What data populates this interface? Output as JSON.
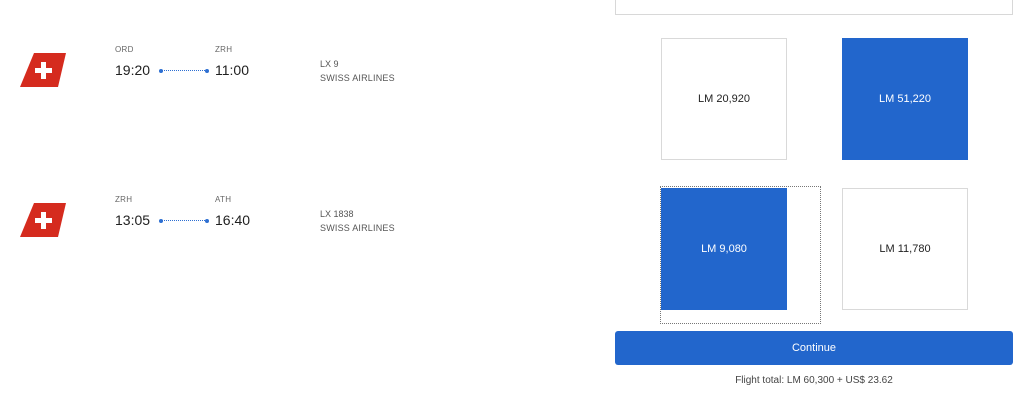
{
  "flights": [
    {
      "origin": "ORD",
      "destination": "ZRH",
      "departure_time": "19:20",
      "arrival_time": "11:00",
      "flight_number": "LX 9",
      "airline": "SWISS AIRLINES",
      "logo_icon": "swiss-tail-logo-icon"
    },
    {
      "origin": "ZRH",
      "destination": "ATH",
      "departure_time": "13:05",
      "arrival_time": "16:40",
      "flight_number": "LX 1838",
      "airline": "SWISS AIRLINES",
      "logo_icon": "swiss-tail-logo-icon"
    }
  ],
  "fares": [
    [
      {
        "price": "LM 20,920",
        "selected": false
      },
      {
        "price": "LM 51,220",
        "selected": true
      }
    ],
    [
      {
        "price": "LM 9,080",
        "selected": true
      },
      {
        "price": "LM 11,780",
        "selected": false
      }
    ]
  ],
  "continue_label": "Continue",
  "flight_total": "Flight total: LM 60,300 + US$ 23.62",
  "colors": {
    "accent": "#2266cc",
    "logo_red": "#d52b1e",
    "route_line": "#2d6fd2"
  }
}
